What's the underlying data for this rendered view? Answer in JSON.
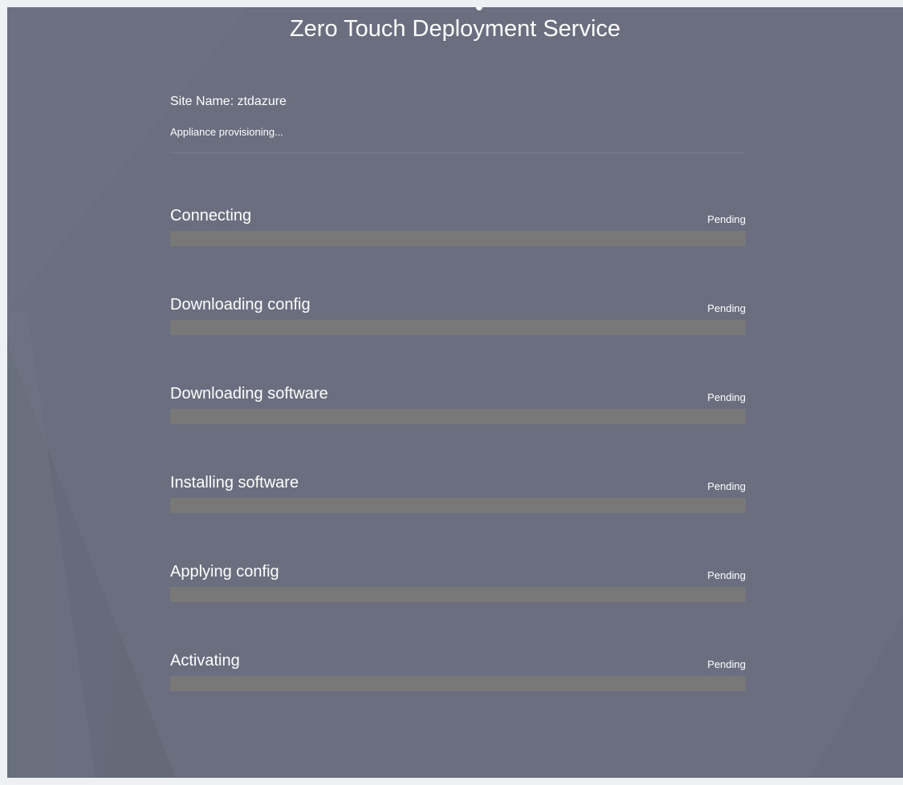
{
  "title": "Zero Touch Deployment Service",
  "site_name": "Site Name: ztdazure",
  "status": "Appliance provisioning...",
  "steps": [
    {
      "label": "Connecting",
      "status": "Pending",
      "progress": 0
    },
    {
      "label": "Downloading config",
      "status": "Pending",
      "progress": 0
    },
    {
      "label": "Downloading software",
      "status": "Pending",
      "progress": 0
    },
    {
      "label": "Installing software",
      "status": "Pending",
      "progress": 0
    },
    {
      "label": "Applying config",
      "status": "Pending",
      "progress": 0
    },
    {
      "label": "Activating",
      "status": "Pending",
      "progress": 0
    }
  ],
  "colors": {
    "background": "#6a6e7e",
    "bar_track": "#787878",
    "bar_fill": "#4aa564",
    "text": "#ffffff"
  }
}
